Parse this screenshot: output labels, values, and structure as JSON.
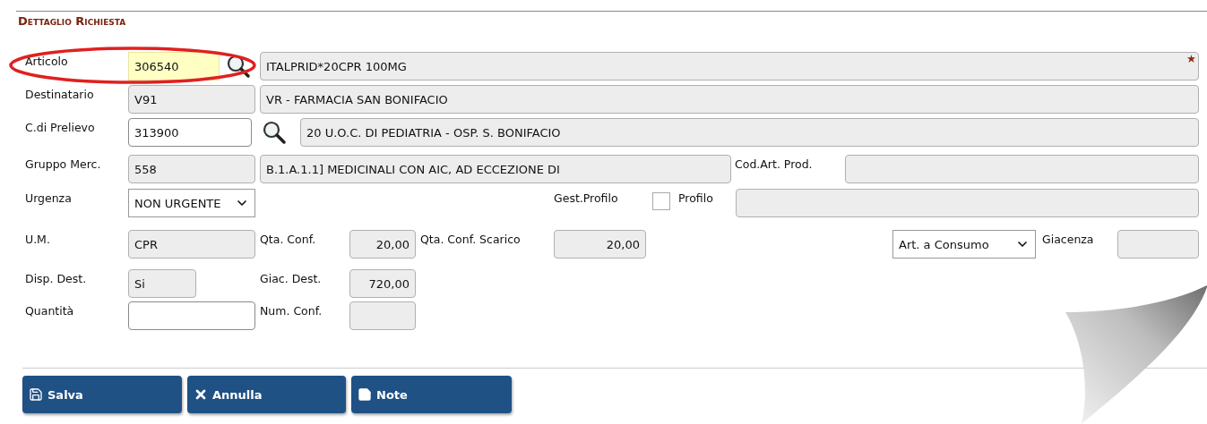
{
  "section_title": "Dettaglio Richiesta",
  "articolo": {
    "label": "Articolo",
    "circled": true,
    "required": true,
    "code": {
      "value": "306540",
      "focused": true
    },
    "description": {
      "value": "ITALPRID*20CPR 100MG",
      "readonly": true
    }
  },
  "destinatario": {
    "label": "Destinatario",
    "code": {
      "value": "V91",
      "readonly": true
    },
    "description": {
      "value": "VR - FARMACIA SAN BONIFACIO",
      "readonly": true
    }
  },
  "prelievo": {
    "label": "C.di Prelievo",
    "code": {
      "value": "313900",
      "readonly": false
    },
    "description": {
      "value": "20 U.O.C. DI PEDIATRIA - OSP. S. BONIFACIO",
      "readonly": true
    }
  },
  "gruppo_merc": {
    "label": "Gruppo Merc.",
    "code": {
      "value": "558",
      "readonly": true
    },
    "description": {
      "value": "B.1.A.1.1] MEDICINALI CON AIC, AD ECCEZIONE DI",
      "readonly": true
    }
  },
  "cod_art_prod": {
    "label": "Cod.Art. Prod.",
    "field": {
      "readonly": true
    }
  },
  "urgenza": {
    "label": "Urgenza",
    "value": "NON URGENTE"
  },
  "gest_profilo": {
    "label": "Gest.Profilo",
    "checked": false
  },
  "profilo": {
    "label": "Profilo",
    "field": {
      "readonly": true
    }
  },
  "um": {
    "label": "U.M.",
    "field": {
      "value": "CPR",
      "readonly": true
    }
  },
  "qta_conf": {
    "label": "Qta. Conf.",
    "field": {
      "value": "20,00",
      "readonly": true
    }
  },
  "qta_conf_scarico": {
    "label": "Qta. Conf. Scarico",
    "field": {
      "value": "20,00",
      "readonly": true
    }
  },
  "tipo_articolo": {
    "value": "Art. a Consumo"
  },
  "giacenza": {
    "label": "Giacenza",
    "field": {
      "readonly": true
    }
  },
  "disp_dest": {
    "label": "Disp. Dest.",
    "field": {
      "value": "Si",
      "readonly": true
    }
  },
  "giac_dest": {
    "label": "Giac. Dest.",
    "field": {
      "value": "720,00",
      "readonly": true
    }
  },
  "quantita": {
    "label": "Quantità",
    "field": {
      "readonly": false
    }
  },
  "num_conf": {
    "label": "Num. Conf.",
    "field": {
      "readonly": true
    }
  },
  "buttons": [
    {
      "kind": "save",
      "label": "Salva"
    },
    {
      "kind": "cancel",
      "label": "Annulla"
    },
    {
      "kind": "note",
      "label": "Note"
    }
  ]
}
